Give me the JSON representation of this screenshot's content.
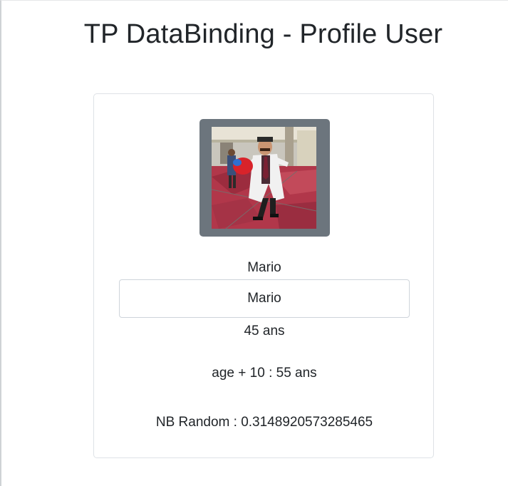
{
  "page": {
    "title": "TP DataBinding - Profile User"
  },
  "profile": {
    "image_alt": "Profile photo",
    "name": "Mario",
    "name_input_value": "Mario",
    "age_value": "45",
    "age_unit": "ans",
    "age_plus_label": "age + 10 :",
    "age_plus_value": "55",
    "random_label": "NB Random :",
    "random_value": "0.3148920573285465"
  }
}
